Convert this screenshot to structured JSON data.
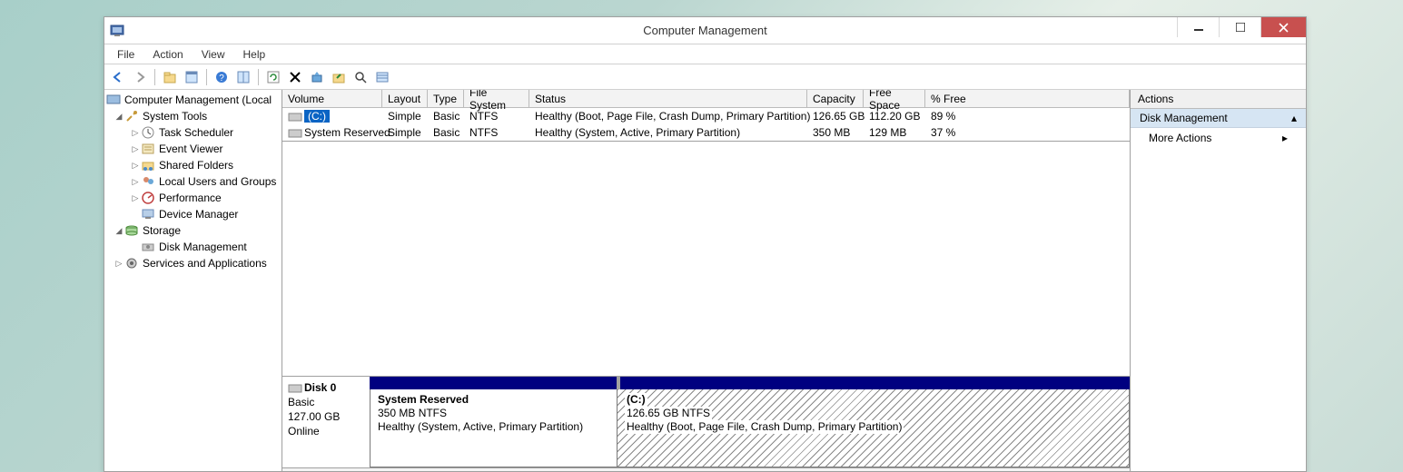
{
  "window": {
    "title": "Computer Management"
  },
  "menubar": [
    "File",
    "Action",
    "View",
    "Help"
  ],
  "tree": {
    "root": "Computer Management (Local",
    "systools": "System Tools",
    "items_systools": [
      "Task Scheduler",
      "Event Viewer",
      "Shared Folders",
      "Local Users and Groups",
      "Performance",
      "Device Manager"
    ],
    "storage": "Storage",
    "diskmgmt": "Disk Management",
    "services": "Services and Applications"
  },
  "table": {
    "headers": {
      "volume": "Volume",
      "layout": "Layout",
      "type": "Type",
      "fs": "File System",
      "status": "Status",
      "capacity": "Capacity",
      "free": "Free Space",
      "pct": "% Free"
    },
    "rows": [
      {
        "volume": "(C:)",
        "layout": "Simple",
        "type": "Basic",
        "fs": "NTFS",
        "status": "Healthy (Boot, Page File, Crash Dump, Primary Partition)",
        "capacity": "126.65 GB",
        "free": "112.20 GB",
        "pct": "89 %",
        "selected": true
      },
      {
        "volume": "System Reserved",
        "layout": "Simple",
        "type": "Basic",
        "fs": "NTFS",
        "status": "Healthy (System, Active, Primary Partition)",
        "capacity": "350 MB",
        "free": "129 MB",
        "pct": "37 %",
        "selected": false
      }
    ]
  },
  "disk": {
    "name": "Disk 0",
    "type": "Basic",
    "size": "127.00 GB",
    "state": "Online",
    "parts": [
      {
        "name": "System Reserved",
        "sub": "350 MB NTFS",
        "status": "Healthy (System, Active, Primary Partition)"
      },
      {
        "name": "(C:)",
        "sub": "126.65 GB NTFS",
        "status": "Healthy (Boot, Page File, Crash Dump, Primary Partition)"
      }
    ]
  },
  "actions": {
    "header": "Actions",
    "group": "Disk Management",
    "more": "More Actions"
  }
}
